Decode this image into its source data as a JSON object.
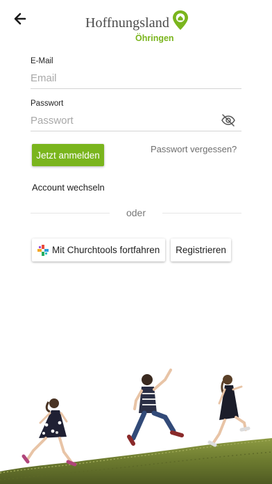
{
  "header": {
    "back_icon": "arrow-left-icon",
    "logo": {
      "name": "Hoffnungsland",
      "location": "Öhringen",
      "pin_icon": "location-pin-house-icon"
    }
  },
  "form": {
    "email": {
      "label": "E-Mail",
      "placeholder": "Email",
      "value": ""
    },
    "password": {
      "label": "Passwort",
      "placeholder": "Passwort",
      "value": "",
      "visibility_icon": "eye-off-icon"
    },
    "login_button": "Jetzt anmelden",
    "forgot_link": "Passwort vergessen?",
    "switch_account": "Account wechseln",
    "divider_text": "oder",
    "churchtools_button": "Mit Churchtools fortfahren",
    "churchtools_icon": "churchtools-logo-icon",
    "register_button": "Registrieren"
  },
  "colors": {
    "accent": "#7ab51d",
    "text": "#1e1e1e",
    "muted": "#6e6e6e",
    "divider": "#d4d4d4"
  },
  "illustration": {
    "icon": "children-running-on-hill-photo"
  }
}
